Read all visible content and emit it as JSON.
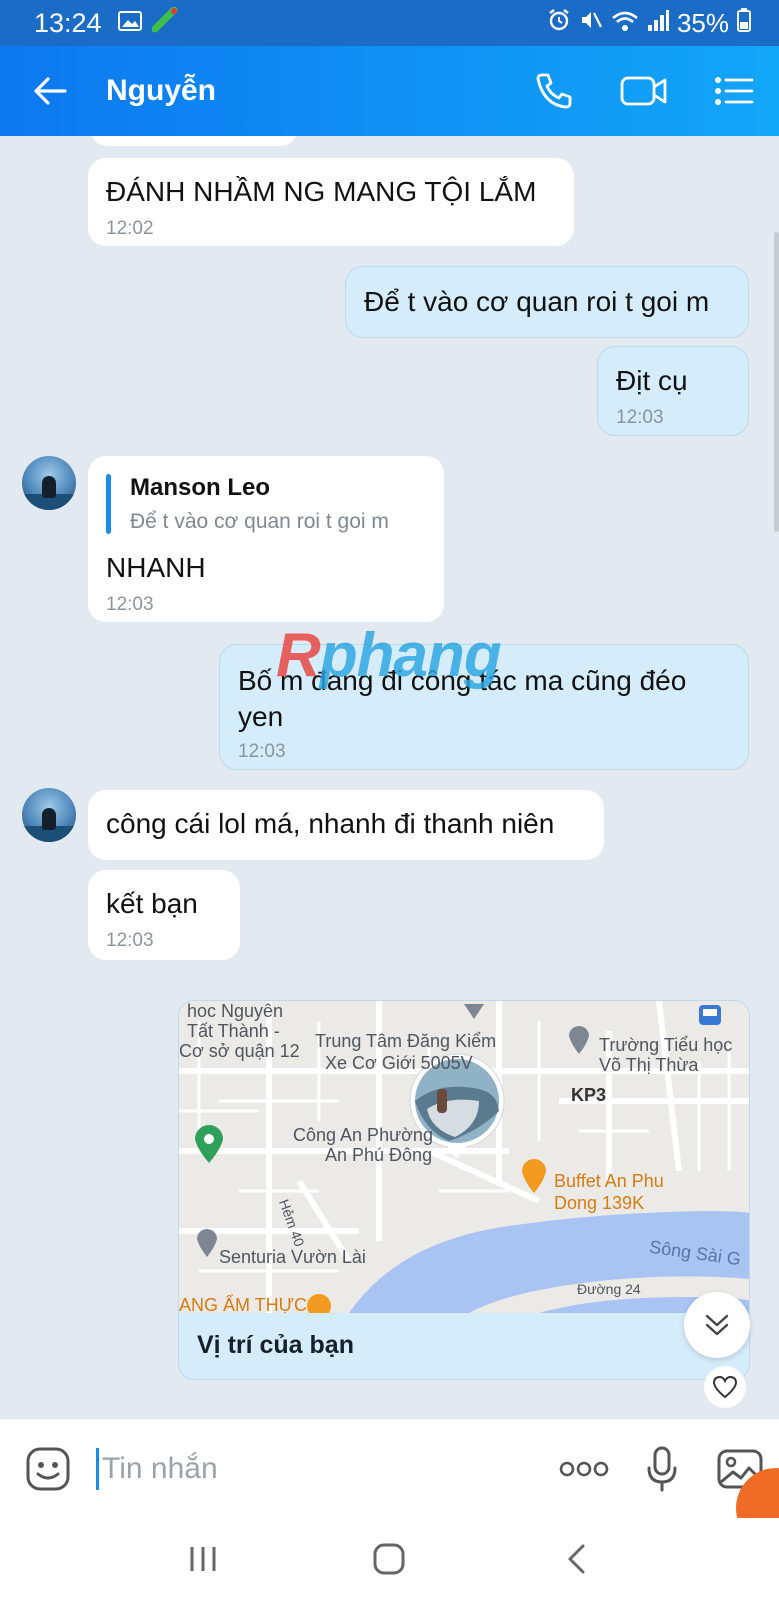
{
  "status_bar": {
    "time": "13:24",
    "battery": "35%",
    "icons": [
      "image-icon",
      "app-icon",
      "alarm-icon",
      "mute-icon",
      "wifi-icon",
      "signal-icon",
      "battery-icon"
    ]
  },
  "header": {
    "title": "Nguyễn",
    "icons": [
      "back-arrow-icon",
      "phone-icon",
      "video-call-icon",
      "menu-list-icon"
    ]
  },
  "messages": [
    {
      "direction": "in",
      "text": "ĐÁNH NHẦM NG MANG TỘI LẮM",
      "time": "12:02"
    },
    {
      "direction": "out",
      "text": "Để t vào cơ quan roi t goi m",
      "time": ""
    },
    {
      "direction": "out",
      "text": "Địt cụ",
      "time": "12:03"
    },
    {
      "direction": "in",
      "reply_to": {
        "name": "Manson Leo",
        "quote": "Để t vào cơ quan roi t goi m"
      },
      "text": "NHANH",
      "time": "12:03"
    },
    {
      "direction": "out",
      "text_line1": "Bố m đang đi công tác ma cũng đéo",
      "text_line2": "yen",
      "time": "12:03"
    },
    {
      "direction": "in",
      "text": "công cái lol má, nhanh đi thanh niên",
      "time": ""
    },
    {
      "direction": "in",
      "text": "kết bạn",
      "time": "12:03"
    }
  ],
  "location_card": {
    "caption": "Vị trí của bạn",
    "map_labels": {
      "l1": "hoc Nguyên",
      "l2": "Tất Thành -",
      "l3": "Cơ sở quận 12",
      "l4": "Trung Tâm Đăng Kiểm",
      "l5": "Xe Cơ Giới 5005V",
      "l6": "Trường Tiểu học",
      "l7": "Võ Thị Thừa",
      "l8": "KP3",
      "l9": "Công An Phường",
      "l10": "An Phú Đông",
      "l11": "Buffet An Phu",
      "l12": "Dong 139K",
      "l13": "Hẻm 40",
      "l14": "Senturia Vườn Lài",
      "l15": "Sông Sài G",
      "l16": "Đường 24",
      "l17": "ANG ẨM THỰC"
    }
  },
  "watermark": {
    "first": "R",
    "rest": "phang"
  },
  "input": {
    "placeholder": "Tin nhắn"
  },
  "colors": {
    "header_start": "#0d78f0",
    "header_end": "#12a6f8",
    "outgoing_bubble": "#d5ecfb",
    "incoming_bubble": "#ffffff",
    "chat_bg": "#e2e9f1",
    "accent": "#1b8be8"
  }
}
